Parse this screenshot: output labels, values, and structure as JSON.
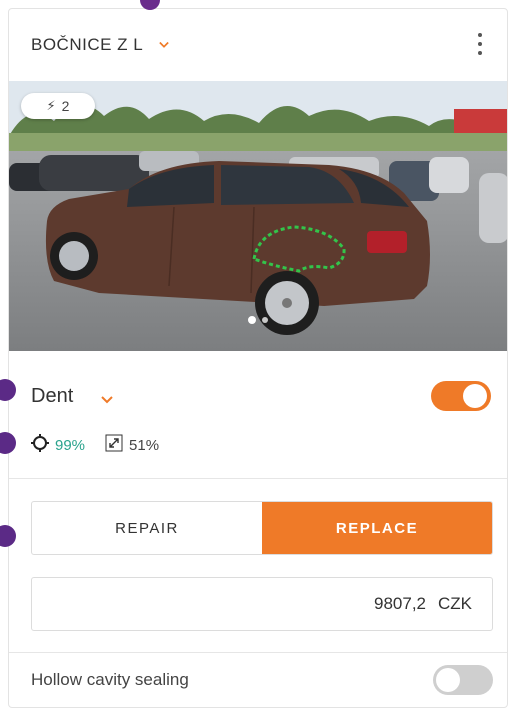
{
  "header": {
    "title": "BOČNICE Z L",
    "dropdown_icon": "chevron-down-icon",
    "menu_icon": "kebab-menu-icon"
  },
  "photo": {
    "badge": {
      "icon": "lightning-icon",
      "count": "2"
    },
    "carousel_pages": 2,
    "carousel_active": 1
  },
  "damage": {
    "type_label": "Dent",
    "enabled": true,
    "confidence_icon": "target-icon",
    "confidence": "99%",
    "size_icon": "expand-icon",
    "size": "51%"
  },
  "actions": {
    "repair_label": "REPAIR",
    "replace_label": "REPLACE",
    "selected": "replace"
  },
  "price": {
    "value": "9807,2",
    "currency": "CZK"
  },
  "hollow": {
    "label": "Hollow cavity sealing",
    "enabled": false
  },
  "colors": {
    "accent": "#ef7a28",
    "teal": "#2aa38d",
    "marker": "#5b2a86"
  }
}
